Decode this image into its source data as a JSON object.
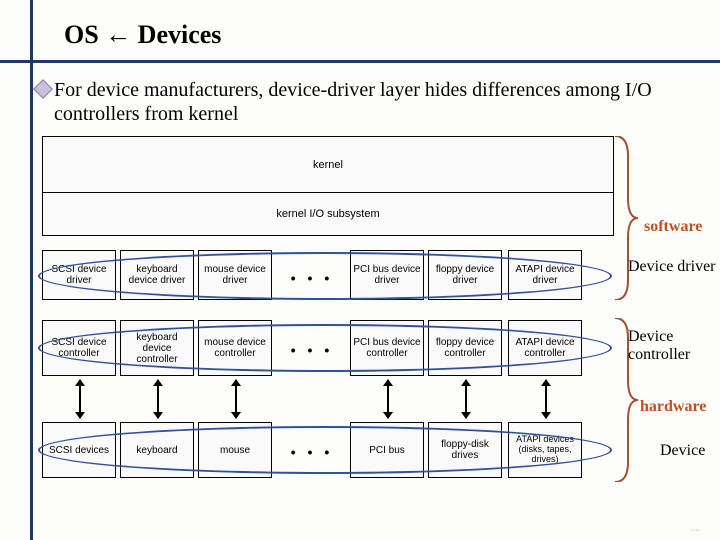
{
  "title": "OS ← Devices",
  "bullet": "For device manufacturers, device-driver layer hides differences among I/O controllers from kernel",
  "kernel": {
    "top": "kernel",
    "bottom": "kernel I/O subsystem"
  },
  "columns": [
    "SCSI",
    "keyboard",
    "mouse",
    "PCI bus",
    "floppy",
    "ATAPI"
  ],
  "drivers": [
    "SCSI device driver",
    "keyboard device driver",
    "mouse device driver",
    "PCI bus device driver",
    "floppy device driver",
    "ATAPI device driver"
  ],
  "controllers": [
    "SCSI device controller",
    "keyboard device controller",
    "mouse device controller",
    "PCI bus device controller",
    "floppy device controller",
    "ATAPI device controller"
  ],
  "devices": [
    "SCSI devices",
    "keyboard",
    "mouse",
    "PCI bus",
    "floppy-disk drives",
    "ATAPI devices (disks, tapes, drives)"
  ],
  "dots": "• • •",
  "labels": {
    "software": "software",
    "hardware": "hardware",
    "driver": "Device driver",
    "controller": "Device controller",
    "device": "Device"
  }
}
